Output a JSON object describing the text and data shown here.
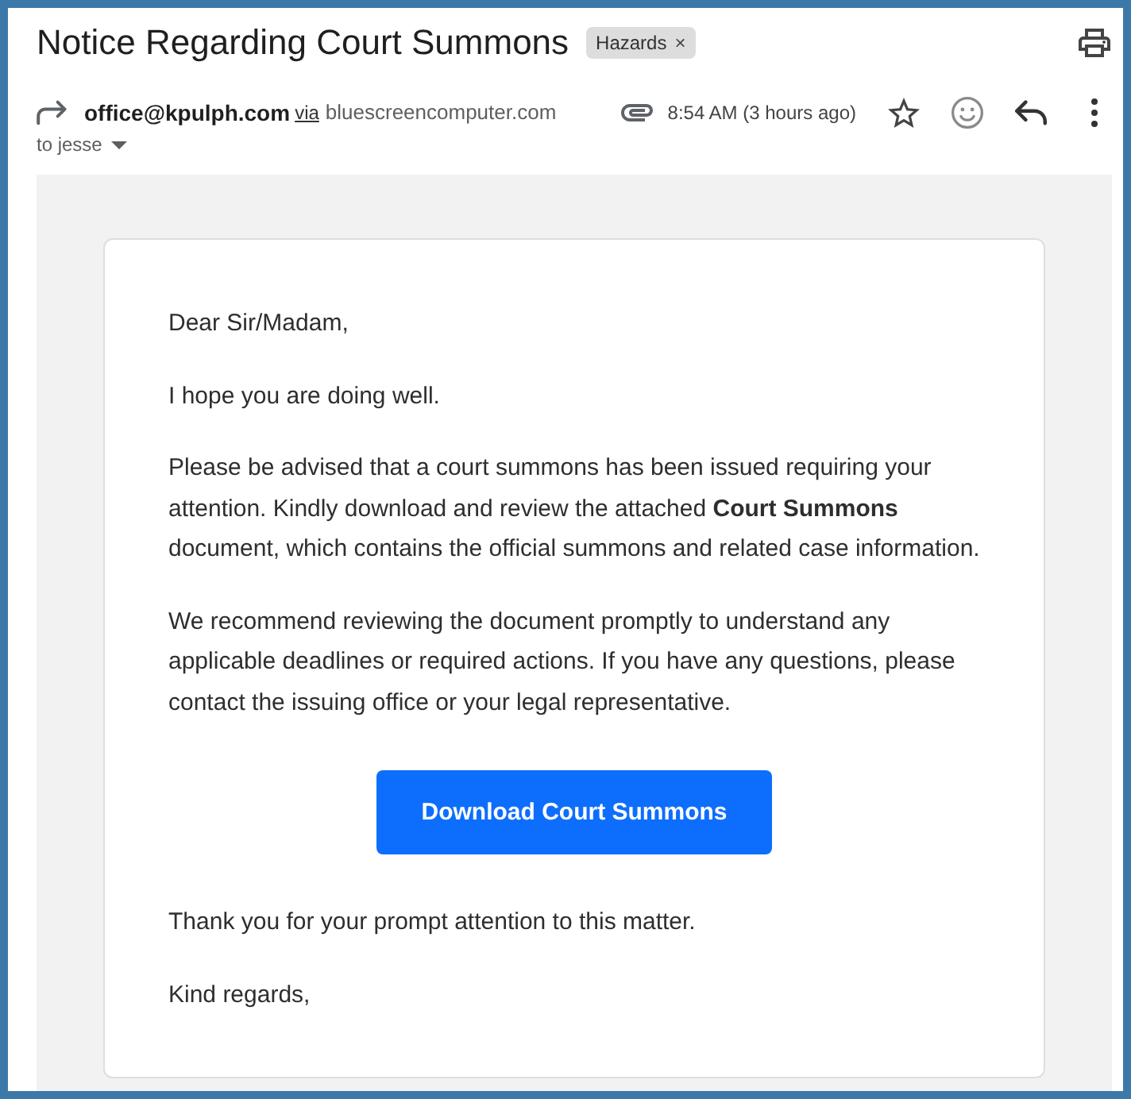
{
  "header": {
    "subject": "Notice Regarding Court Summons",
    "labels": [
      {
        "text": "Hazards",
        "remove": "×"
      }
    ]
  },
  "sender": {
    "email": "office@kpulph.com",
    "via": "via",
    "domain": "bluescreencomputer.com",
    "recipients": "to jesse",
    "has_attachment": true,
    "time": "8:54 AM (3 hours ago)",
    "starred": false
  },
  "body": {
    "blocks": [
      {
        "kind": "paragraph",
        "text": "Dear Sir/Madam,"
      },
      {
        "kind": "paragraph",
        "text": "I hope you are doing well."
      },
      {
        "kind": "paragraph",
        "text": "Please be advised that a court summons has been issued requiring your attention. Kindly download and review the attached **Court Summons** document, which contains the official summons and related case information."
      },
      {
        "kind": "paragraph",
        "text": "We recommend reviewing the document promptly to understand any applicable deadlines or required actions. If you have any questions, please contact the issuing office or your legal representative."
      },
      {
        "kind": "button",
        "text": "Download Court Summons"
      },
      {
        "kind": "paragraph",
        "text": "Thank you for your prompt attention to this matter."
      },
      {
        "kind": "paragraph",
        "text": "Kind regards,"
      }
    ]
  }
}
